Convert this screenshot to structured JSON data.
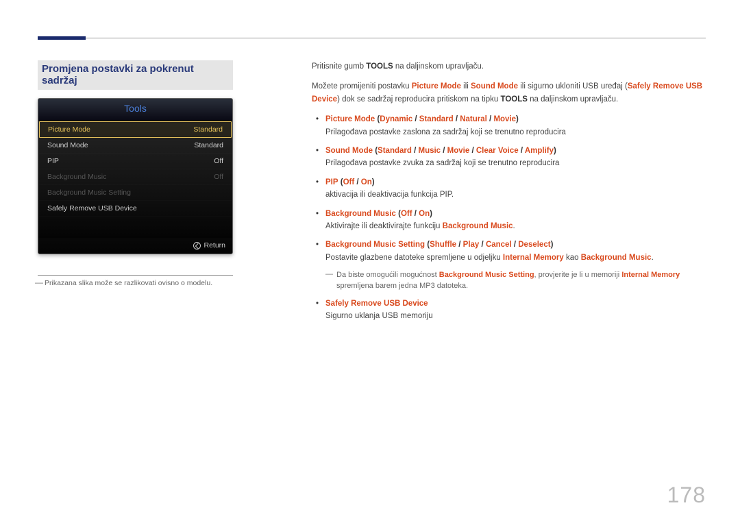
{
  "section_title": "Promjena postavki za pokrenut sadržaj",
  "tools_panel": {
    "header": "Tools",
    "rows": [
      {
        "label": "Picture Mode",
        "value": "Standard",
        "state": "selected"
      },
      {
        "label": "Sound Mode",
        "value": "Standard",
        "state": "normal"
      },
      {
        "label": "PIP",
        "value": "Off",
        "state": "normal"
      },
      {
        "label": "Background Music",
        "value": "Off",
        "state": "disabled"
      },
      {
        "label": "Background Music Setting",
        "value": "",
        "state": "disabled"
      },
      {
        "label": "Safely Remove USB Device",
        "value": "",
        "state": "normal"
      }
    ],
    "footer_return": "Return"
  },
  "left_footnote": "Prikazana slika može se razlikovati ovisno o modelu.",
  "intro1_pre": "Pritisnite gumb ",
  "intro1_bold": "TOOLS",
  "intro1_post": " na daljinskom upravljaču.",
  "intro2_a": "Možete promijeniti postavku ",
  "intro2_b": " ili ",
  "intro2_c": " ili sigurno ukloniti USB uređaj (",
  "intro2_d": ") dok se sadržaj reproducira pritiskom na tipku ",
  "intro2_e": " na daljinskom upravljaču.",
  "kw": {
    "picture_mode": "Picture Mode",
    "sound_mode": "Sound Mode",
    "safely_remove": "Safely Remove USB Device",
    "dynamic": "Dynamic",
    "standard": "Standard",
    "natural": "Natural",
    "movie": "Movie",
    "music": "Music",
    "clear_voice": "Clear Voice",
    "amplify": "Amplify",
    "pip": "PIP",
    "off": "Off",
    "on": "On",
    "bg_music": "Background Music",
    "bg_music_setting": "Background Music Setting",
    "shuffle": "Shuffle",
    "play": "Play",
    "cancel": "Cancel",
    "deselect": "Deselect",
    "internal_memory": "Internal Memory",
    "tools": "TOOLS"
  },
  "desc": {
    "picture_mode": "Prilagođava postavke zaslona za sadržaj koji se trenutno reproducira",
    "sound_mode": "Prilagođava postavke zvuka za sadržaj koji se trenutno reproducira",
    "pip": "aktivacija ili deaktivacija funkcija PIP.",
    "bg_music_pre": "Aktivirajte ili deaktivirajte funkciju ",
    "bg_music_post": ".",
    "bg_setting_pre": "Postavite glazbene datoteke spremljene u odjeljku ",
    "bg_setting_mid": " kao ",
    "bg_setting_post": ".",
    "note_pre": "Da biste omogućili mogućnost ",
    "note_mid1": ", provjerite je li u memoriji ",
    "note_post": " spremljena barem jedna MP3 datoteka.",
    "safely_remove": "Sigurno uklanja USB memoriju"
  },
  "page_number": "178"
}
